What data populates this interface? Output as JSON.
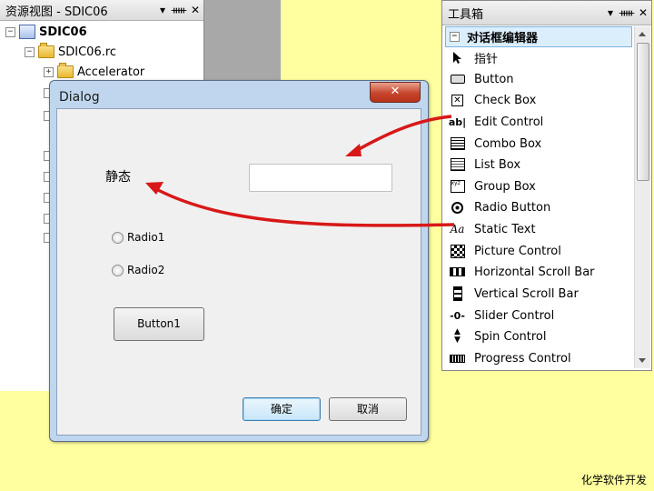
{
  "resource_view": {
    "title": "资源视图 - SDIC06",
    "pin": "▾ ⊣ ✕",
    "items": [
      {
        "label": "SDIC06",
        "expander": "−"
      },
      {
        "label": "SDIC06.rc",
        "expander": "−"
      },
      {
        "label": "Accelerator",
        "expander": "+"
      }
    ]
  },
  "dialog": {
    "title": "Dialog",
    "close": "✕",
    "static_text": "静态",
    "radios": [
      "Radio1",
      "Radio2"
    ],
    "button": "Button1",
    "ok": "确定",
    "cancel": "取消"
  },
  "toolbox": {
    "title": "工具箱",
    "header": "对话框编辑器",
    "header_expander": "−",
    "items": [
      {
        "label": "指针",
        "icon": "pointer-icon"
      },
      {
        "label": "Button",
        "icon": "button-icon"
      },
      {
        "label": "Check Box",
        "icon": "checkbox-icon"
      },
      {
        "label": "Edit Control",
        "icon": "edit-control-icon"
      },
      {
        "label": "Combo Box",
        "icon": "combo-box-icon"
      },
      {
        "label": "List Box",
        "icon": "list-box-icon"
      },
      {
        "label": "Group Box",
        "icon": "group-box-icon"
      },
      {
        "label": "Radio Button",
        "icon": "radio-button-icon"
      },
      {
        "label": "Static Text",
        "icon": "static-text-icon"
      },
      {
        "label": "Picture Control",
        "icon": "picture-control-icon"
      },
      {
        "label": "Horizontal Scroll Bar",
        "icon": "hscroll-icon"
      },
      {
        "label": "Vertical Scroll Bar",
        "icon": "vscroll-icon"
      },
      {
        "label": "Slider Control",
        "icon": "slider-icon"
      },
      {
        "label": "Spin Control",
        "icon": "spin-icon"
      },
      {
        "label": "Progress Control",
        "icon": "progress-icon"
      }
    ]
  },
  "footer": "化学软件开发",
  "colors": {
    "arrow": "#d81818",
    "background": "#ffffa0",
    "dialog_frame": "#bfd6ee"
  }
}
